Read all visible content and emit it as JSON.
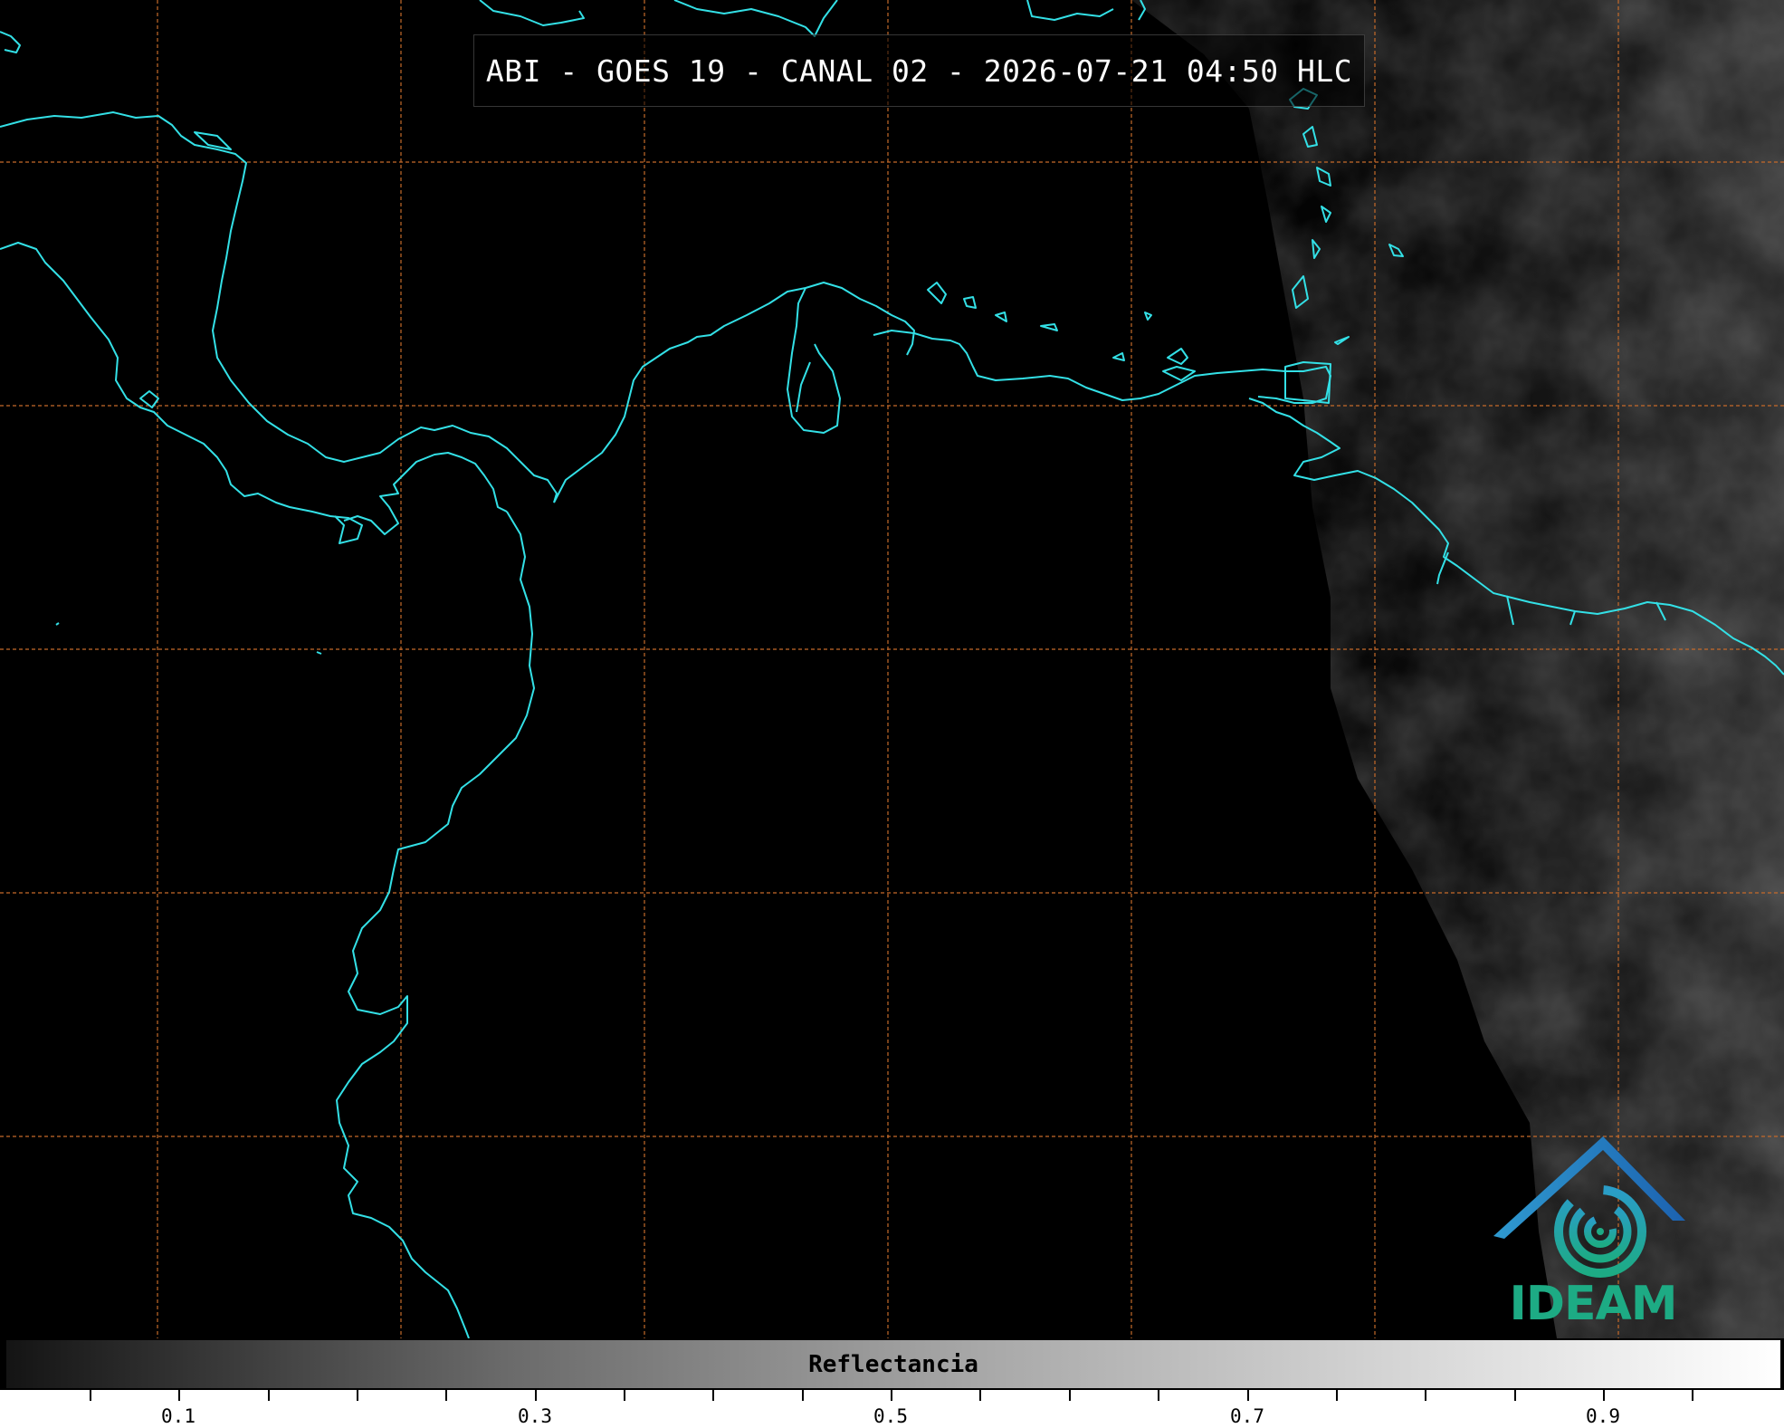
{
  "map": {
    "title": "ABI - GOES 19 - CANAL 02 - 2026-07-21 04:50 HLC",
    "coastline_color": "#33e0e6",
    "gridline_color": "#c56a2a",
    "background_color": "#000000",
    "cloud_tone": "gray-white reflectance"
  },
  "logo": {
    "text": "IDEAM",
    "icon": "ideam-swirl-roof-logo",
    "colors": [
      "#2a6cb5",
      "#1dab84"
    ]
  },
  "colorbar": {
    "label": "Reflectancia",
    "tick_labels": [
      "0.1",
      "0.3",
      "0.5",
      "0.7",
      "0.9"
    ],
    "tick_values": [
      0.1,
      0.3,
      0.5,
      0.7,
      0.9
    ],
    "range": [
      0.0,
      1.0
    ],
    "colors": [
      "#141414",
      "#ffffff"
    ]
  }
}
